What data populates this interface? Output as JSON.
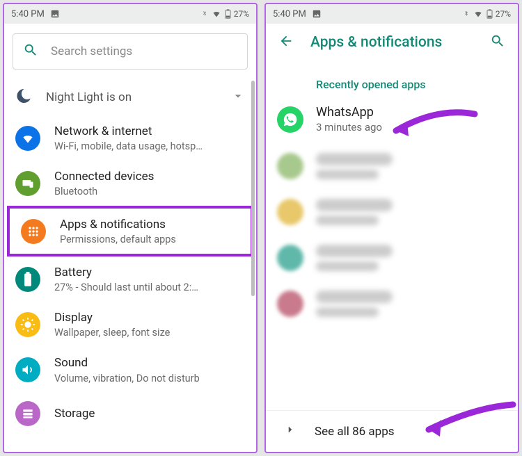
{
  "status": {
    "time": "5:40 PM",
    "battery": "27%"
  },
  "search": {
    "placeholder": "Search settings"
  },
  "nightlight": {
    "label": "Night Light is on"
  },
  "settings": [
    {
      "title": "Network & internet",
      "sub": "Wi-Fi, mobile, data usage, hotsp…"
    },
    {
      "title": "Connected devices",
      "sub": "Bluetooth"
    },
    {
      "title": "Apps & notifications",
      "sub": "Permissions, default apps"
    },
    {
      "title": "Battery",
      "sub": "27% - Should last until about 2:…"
    },
    {
      "title": "Display",
      "sub": "Wallpaper, sleep, font size"
    },
    {
      "title": "Sound",
      "sub": "Volume, vibration, Do not disturb"
    },
    {
      "title": "Storage",
      "sub": ""
    }
  ],
  "apps_screen": {
    "title": "Apps & notifications",
    "section": "Recently opened apps",
    "whatsapp": {
      "name": "WhatsApp",
      "sub": "3 minutes ago"
    },
    "see_all": "See all 86 apps"
  }
}
